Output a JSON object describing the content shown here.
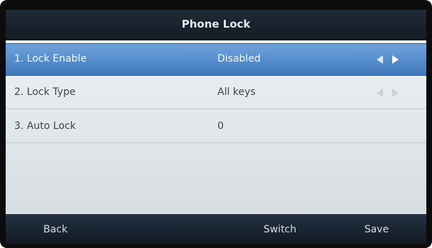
{
  "screen": {
    "title": "Phone Lock"
  },
  "settings": {
    "rows": [
      {
        "label": "1. Lock Enable",
        "value": "Disabled"
      },
      {
        "label": "2. Lock Type",
        "value": "All keys"
      },
      {
        "label": "3. Auto Lock",
        "value": "0"
      }
    ],
    "selected_index": 0
  },
  "softkeys": {
    "back": "Back",
    "switch": "Switch",
    "save": "Save"
  },
  "colors": {
    "selection": "#3f78bd",
    "title_bar": "#1f2a36",
    "softkey_bar": "#121a23"
  },
  "icons": {
    "option_switch": "left-right-arrows"
  }
}
